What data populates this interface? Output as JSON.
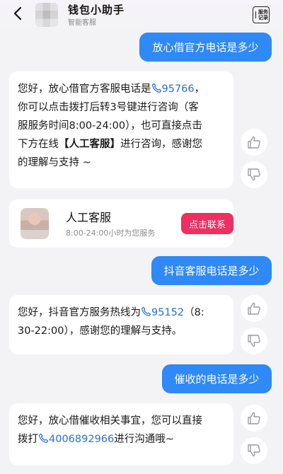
{
  "header": {
    "title": "钱包小助手",
    "subtitle": "智能客服",
    "record_label_line1": "服务",
    "record_label_line2": "记录"
  },
  "messages": [
    {
      "role": "user",
      "text": "放心借官方电话是多少"
    },
    {
      "role": "bot",
      "pre": "您好，放心借官方客服电话是",
      "phone": "95766",
      "post_line1": "，",
      "lines": [
        "你可以点击拨打后转3号键进行咨询（客",
        "服服务时间8:00-24:00），也可直接点击",
        "下方在线",
        "【人工客服】",
        "进行咨询，感谢您",
        "的理解与支持 ~"
      ]
    },
    {
      "role": "user",
      "text": "抖音客服电话是多少"
    },
    {
      "role": "bot",
      "pre": "您好，抖音官方服务热线为",
      "phone": "95152",
      "post": "（8:",
      "line2": "30-22:00），感谢您的理解与支持。"
    },
    {
      "role": "user",
      "text": "催收的电话是多少"
    },
    {
      "role": "bot",
      "line1": "您好，放心借催收相关事宜，您可以直接",
      "pre2": "拨打",
      "phone": "4006892966",
      "post2": "进行沟通哦~"
    }
  ],
  "agent_card": {
    "name": "人工客服",
    "hours": "8:00-24:00小时为您服务",
    "button": "点击联系"
  },
  "colors": {
    "user_bubble": "#2f89f6",
    "contact_button": "#ee2f61",
    "phone_link": "#2a6fd6",
    "background": "#f3f3f5"
  },
  "icons": [
    "back-arrow-icon",
    "service-record-icon",
    "phone-icon",
    "thumbs-up-icon",
    "thumbs-down-icon"
  ]
}
